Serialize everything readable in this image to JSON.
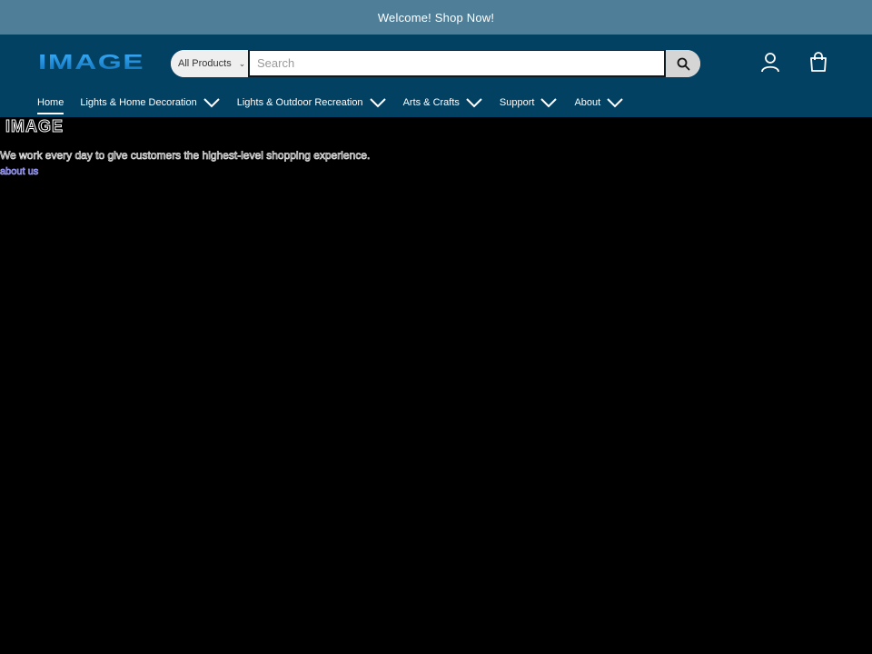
{
  "announcement": {
    "text": "Welcome! Shop Now!"
  },
  "header": {
    "logo_text": "IMAGE",
    "search": {
      "category": "All Products",
      "placeholder": "Search"
    },
    "icons": {
      "search": "search-icon",
      "account": "account-icon",
      "cart": "cart-icon"
    },
    "colors": {
      "bar": "#4f7f98",
      "header": "#034162",
      "logo": "#1e8fd6"
    }
  },
  "nav": {
    "items": [
      {
        "label": "Home",
        "active": true,
        "dropdown": false
      },
      {
        "label": "Lights & Home Decoration",
        "dropdown": true
      },
      {
        "label": "Lights & Outdoor Recreation",
        "dropdown": true
      },
      {
        "label": "Arts & Crafts",
        "dropdown": true
      },
      {
        "label": "Support",
        "dropdown": true
      },
      {
        "label": "About",
        "dropdown": true
      }
    ]
  },
  "main": {
    "heading": "IMAGE",
    "tagline": "We work every day to give customers the highest-level shopping experience.",
    "about_link": "about us"
  }
}
